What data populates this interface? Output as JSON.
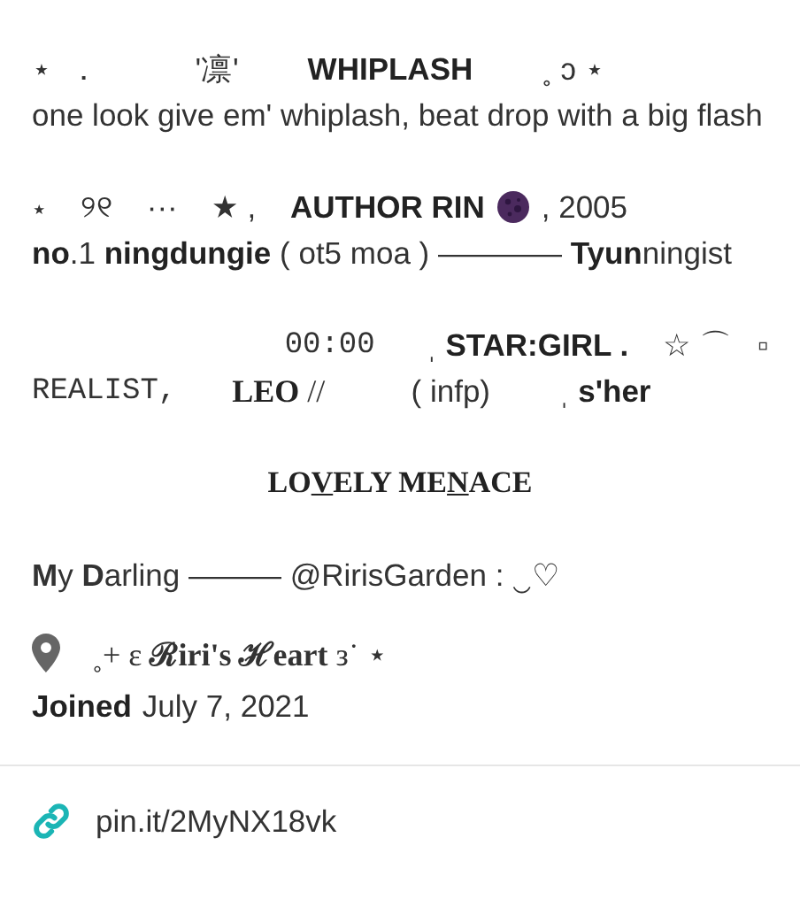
{
  "paragraphs": [
    [
      {
        "segments": [
          {
            "kind": "sans",
            "text": "⋆  ．           '凛'        **WHIPLASH**        ˳ ↄ ⋆"
          }
        ]
      },
      {
        "segments": [
          {
            "kind": "sans",
            "text": "one look give em' whiplash, beat drop with a big flash"
          }
        ]
      }
    ],
    [
      {
        "segments": [
          {
            "kind": "sans",
            "text": "⋆    ୨୧    ···    ★ ,    **AUTHOR RIN**"
          },
          {
            "kind": "planet"
          },
          {
            "kind": "sans",
            "text": ", 2005"
          }
        ]
      },
      {
        "segments": [
          {
            "kind": "sans",
            "text": "**no**.1 **ningdungie** ( ot5 moa ) ———— **Tyun**ningist"
          }
        ]
      }
    ],
    [
      {
        "segments": [
          {
            "kind": "mono",
            "text": "              00:00"
          },
          {
            "kind": "sans",
            "text": "      ˌ **STAR:GIRL .**    ☆ ⌒   ▫"
          }
        ]
      },
      {
        "segments": [
          {
            "kind": "mono",
            "text": "REALIST,"
          },
          {
            "kind": "serif",
            "text": "       **LEO** //"
          },
          {
            "kind": "sans",
            "text": "          ( infp)        ˌ **s'her**"
          }
        ]
      }
    ]
  ],
  "heading": [
    {
      "text": "LO",
      "underline": false
    },
    {
      "text": "V",
      "underline": true
    },
    {
      "text": "ELY ME",
      "underline": false
    },
    {
      "text": "N",
      "underline": true
    },
    {
      "text": "ACE",
      "underline": false
    }
  ],
  "tagline": "**M**y **D**arling ——— @RirisGarden : ‿♡",
  "location": "˳+ ɛ **ℛiri's ℋeart** з˙ ⋆",
  "joined": {
    "label": "Joined",
    "date": "July 7, 2021"
  },
  "link": "pin.it/2MyNX18vk"
}
